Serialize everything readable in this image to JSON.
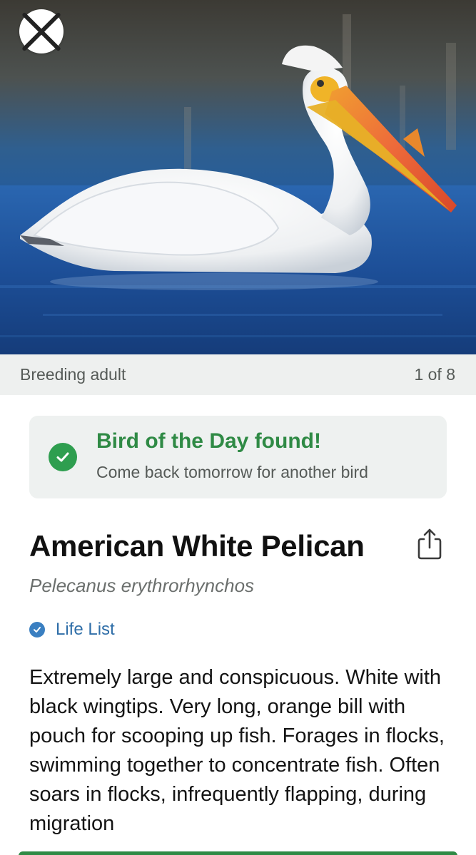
{
  "photo": {
    "caption": "Breeding adult",
    "counter": "1 of 8"
  },
  "icons": {
    "close": "close-icon",
    "check": "check-circle-icon",
    "share": "share-icon",
    "life_list": "check-badge-icon"
  },
  "found_banner": {
    "title": "Bird of the Day found!",
    "subtitle": "Come back tomorrow for another bird"
  },
  "species": {
    "common_name": "American White Pelican",
    "scientific_name": "Pelecanus erythrorhynchos",
    "life_list_label": "Life List",
    "description": "Extremely large and conspicuous. White with black wingtips. Very long, orange bill with pouch for scooping up fish. Forages in flocks, swimming together to concentrate fish. Often soars in flocks, infrequently flapping, during migration"
  },
  "colors": {
    "accent_green": "#2f8a45",
    "link_blue": "#2f6ea8",
    "caption_bg": "#eef0ef"
  }
}
